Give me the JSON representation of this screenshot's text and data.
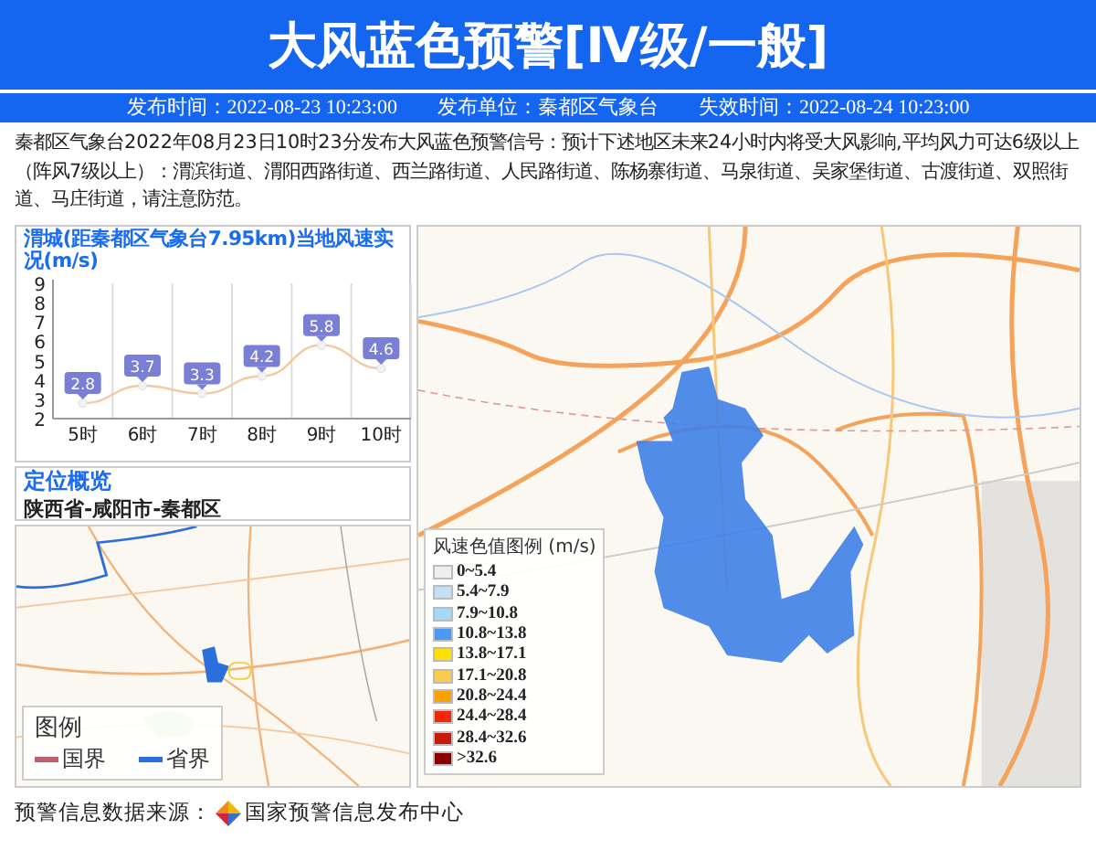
{
  "header": {
    "title": "大风蓝色预警[Ⅳ级/一般]",
    "publish_time": "发布时间：2022-08-23 10:23:00",
    "publisher": "发布单位：秦都区气象台",
    "expire_time": "失效时间：2022-08-24 10:23:00"
  },
  "description": "秦都区气象台2022年08月23日10时23分发布大风蓝色预警信号：预计下述地区未来24小时内将受大风影响,平均风力可达6级以上（阵风7级以上）：渭滨街道、渭阳西路街道、西兰路街道、人民路街道、陈杨寨街道、马泉街道、吴家堡街道、古渡街道、双照街道、马庄街道，请注意防范。",
  "wind_panel": {
    "title": "渭城(距秦都区气象台7.95km)当地风速实况(m/s)",
    "chart_data": {
      "type": "line",
      "categories": [
        "5时",
        "6时",
        "7时",
        "8时",
        "9时",
        "10时"
      ],
      "series": [
        {
          "color": "#f5c9a0",
          "marker": true,
          "values": [
            2.8,
            3.7,
            3.3,
            4.2,
            5.8,
            4.6
          ]
        }
      ],
      "ylim": [
        2,
        9
      ],
      "yticks": [
        2,
        3,
        4,
        5,
        6,
        7,
        8,
        9
      ],
      "data_labels": true
    }
  },
  "location": {
    "title": "定位概览",
    "path": "陕西省-咸阳市-秦都区"
  },
  "overview_map": {
    "legend_title": "图例",
    "legend_items": [
      {
        "label": "国界",
        "color": "#c0606e"
      },
      {
        "label": "省界",
        "color": "#2a6fdb"
      }
    ]
  },
  "detail_map": {
    "legend_title": "风速色值图例 (m/s)",
    "legend_items": [
      {
        "label": "0~5.4",
        "color": "#eeeeee"
      },
      {
        "label": "5.4~7.9",
        "color": "#c5def5"
      },
      {
        "label": "7.9~10.8",
        "color": "#a6d8f8"
      },
      {
        "label": "10.8~13.8",
        "color": "#4a9af5"
      },
      {
        "label": "13.8~17.1",
        "color": "#ffe000"
      },
      {
        "label": "17.1~20.8",
        "color": "#fdca50"
      },
      {
        "label": "20.8~24.4",
        "color": "#fca00a"
      },
      {
        "label": "24.4~28.4",
        "color": "#f5260a"
      },
      {
        "label": "28.4~32.6",
        "color": "#c81a08"
      },
      {
        "label": ">32.6",
        "color": "#8a0000"
      }
    ]
  },
  "footer": {
    "source_label": "预警信息数据来源：",
    "source_name": "国家预警信息发布中心"
  }
}
